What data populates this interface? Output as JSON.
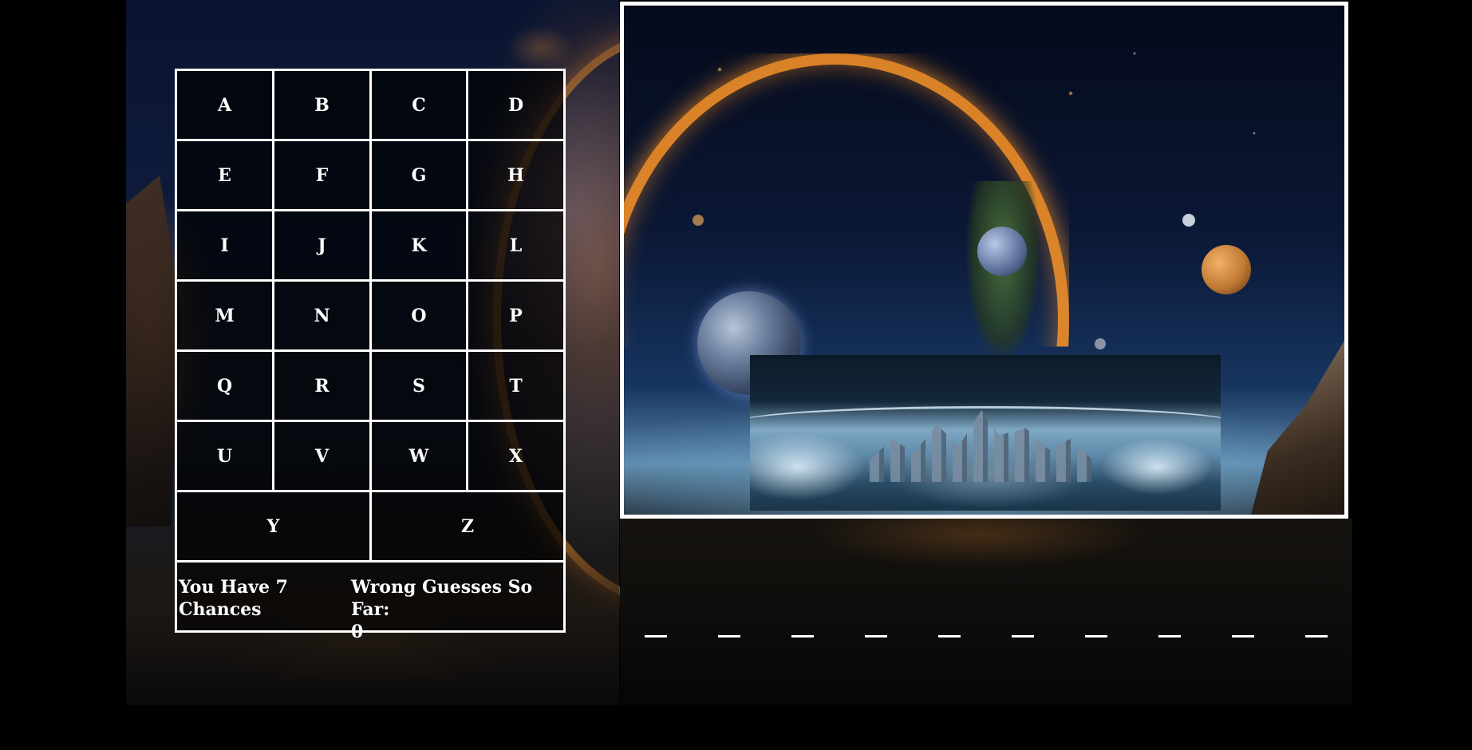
{
  "keyboard": {
    "keys": [
      "A",
      "B",
      "C",
      "D",
      "E",
      "F",
      "G",
      "H",
      "I",
      "J",
      "K",
      "L",
      "M",
      "N",
      "O",
      "P",
      "Q",
      "R",
      "S",
      "T",
      "U",
      "V",
      "W",
      "X",
      "Y",
      "Z"
    ]
  },
  "status": {
    "chances_text": "You Have 7 Chances",
    "wrong_label": "Wrong Guesses So Far:",
    "wrong_count": "0"
  },
  "word": {
    "blanks": [
      "_",
      "_",
      "_",
      "_",
      "_",
      "_",
      "_",
      "_",
      "_",
      "_"
    ]
  },
  "colors": {
    "grid_border": "#ffffff",
    "text": "#ffffff",
    "background": "#000000"
  }
}
